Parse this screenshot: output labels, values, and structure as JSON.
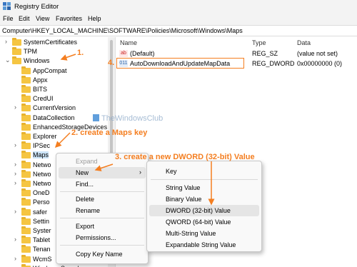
{
  "window": {
    "title": "Registry Editor"
  },
  "menubar": {
    "items": [
      "File",
      "Edit",
      "View",
      "Favorites",
      "Help"
    ]
  },
  "address": {
    "path": "Computer\\HKEY_LOCAL_MACHINE\\SOFTWARE\\Policies\\Microsoft\\Windows\\Maps"
  },
  "tree": {
    "items": [
      {
        "label": "SystemCertificates",
        "expand": ">"
      },
      {
        "label": "TPM",
        "expand": ""
      },
      {
        "label": "Windows",
        "expand": "v"
      },
      {
        "label": "AppCompat",
        "expand": ""
      },
      {
        "label": "Appx",
        "expand": ""
      },
      {
        "label": "BITS",
        "expand": ""
      },
      {
        "label": "CredUI",
        "expand": ""
      },
      {
        "label": "CurrentVersion",
        "expand": ">"
      },
      {
        "label": "DataCollection",
        "expand": ""
      },
      {
        "label": "EnhancedStorageDevices",
        "expand": ""
      },
      {
        "label": "Explorer",
        "expand": ""
      },
      {
        "label": "IPSec",
        "expand": ">"
      },
      {
        "label": "Maps",
        "expand": ""
      },
      {
        "label": "Netwo",
        "expand": ">"
      },
      {
        "label": "Netwo",
        "expand": ">"
      },
      {
        "label": "Netwo",
        "expand": ">"
      },
      {
        "label": "OneD",
        "expand": ""
      },
      {
        "label": "Perso",
        "expand": ""
      },
      {
        "label": "safer",
        "expand": ">"
      },
      {
        "label": "Settin",
        "expand": ""
      },
      {
        "label": "Syster",
        "expand": ""
      },
      {
        "label": "Tablet",
        "expand": ">"
      },
      {
        "label": "Tenan",
        "expand": ""
      },
      {
        "label": "WcmS",
        "expand": ">"
      },
      {
        "label": "Windows Search",
        "expand": ""
      }
    ]
  },
  "values": {
    "headers": {
      "name": "Name",
      "type": "Type",
      "data": "Data"
    },
    "rows": [
      {
        "icon": "ab",
        "name": "(Default)",
        "type": "REG_SZ",
        "data": "(value not set)"
      },
      {
        "icon": "011",
        "name": "AutoDownloadAndUpdateMapData",
        "type": "REG_DWORD",
        "data": "0x00000000 (0)"
      }
    ]
  },
  "context_menu": {
    "items": [
      "Expand",
      "New",
      "Find...",
      "Delete",
      "Rename",
      "Export",
      "Permissions...",
      "Copy Key Name"
    ],
    "submenu_arrow": ">"
  },
  "submenu": {
    "items": [
      "Key",
      "String Value",
      "Binary Value",
      "DWORD (32-bit) Value",
      "QWORD (64-bit) Value",
      "Multi-String Value",
      "Expandable String Value"
    ]
  },
  "annotations": {
    "step1": "1.",
    "step2": "2. create a Maps key",
    "step3": "3. create a new DWORD (32-bit) Value",
    "step4": "4."
  },
  "watermark": {
    "text": "TheWindowsClub"
  },
  "colors": {
    "accent": "#f47e20",
    "folder": "#f5c542",
    "selection": "#cce4f7"
  }
}
